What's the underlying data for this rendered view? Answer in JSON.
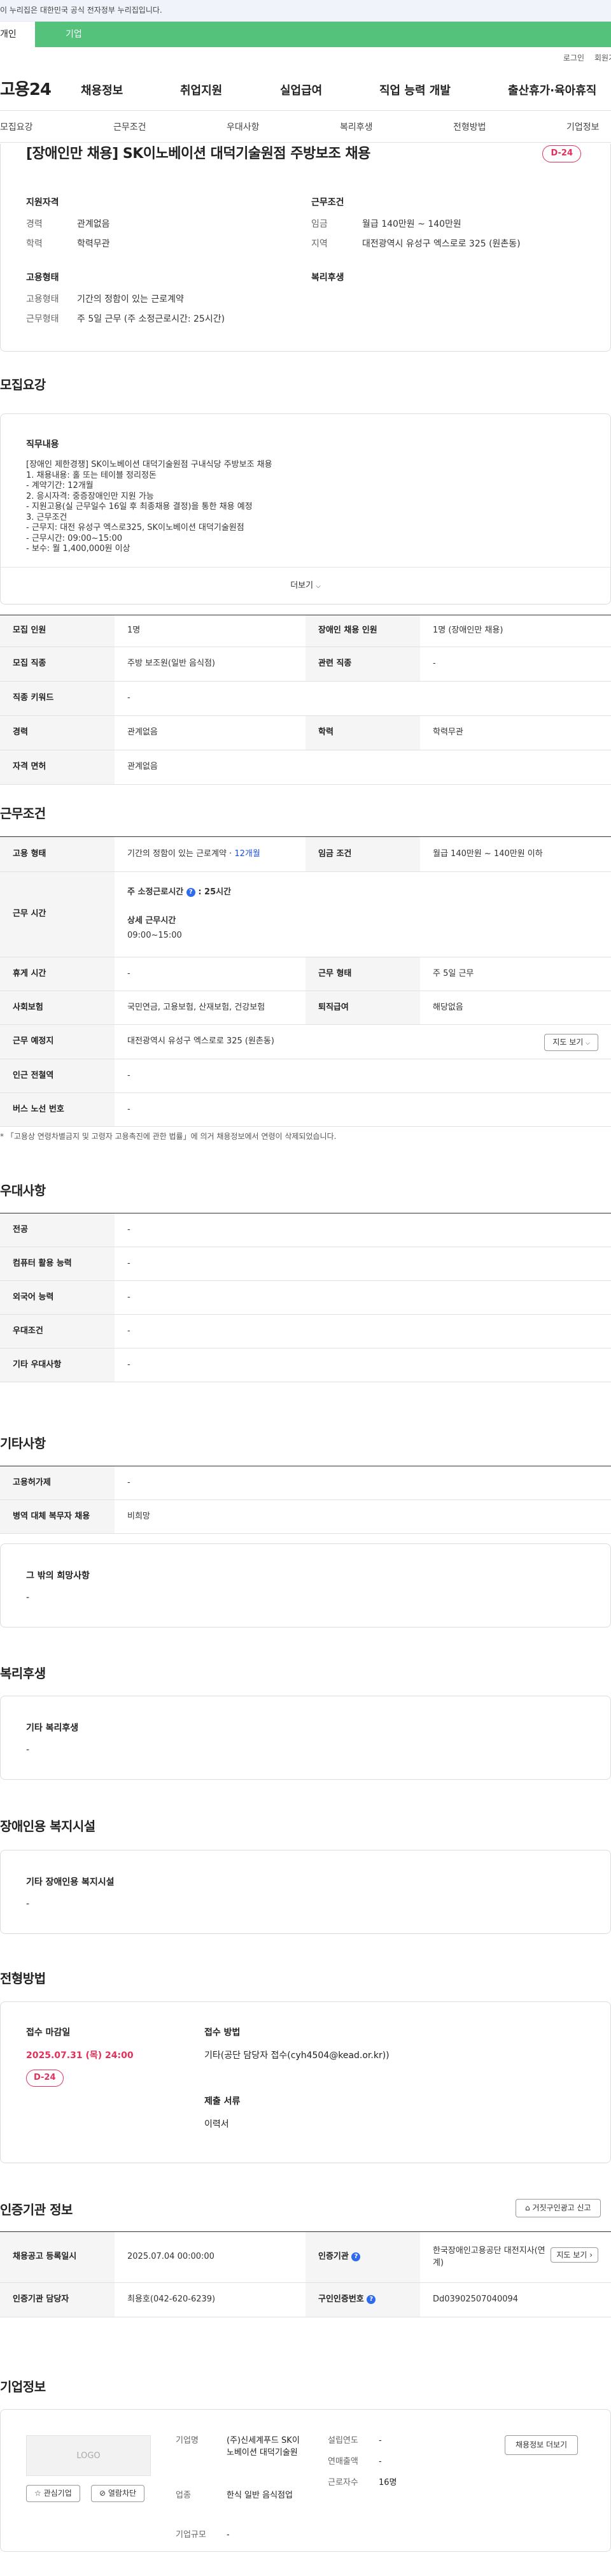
{
  "gov_banner": "이 누리집은 대한민국 공식 전자정부 누리집입니다.",
  "top_tabs": [
    "개인",
    "기업"
  ],
  "util_links": [
    "로그인",
    "회원가입"
  ],
  "logo": "고용24",
  "gnb": [
    "채용정보",
    "취업지원",
    "실업급여",
    "직업 능력 개발",
    "출산휴가·육아휴직"
  ],
  "subnav": [
    "모집요강",
    "근무조건",
    "우대사항",
    "복리후생",
    "전형방법",
    "기업정보"
  ],
  "job": {
    "title": "[장애인만 채용] SK이노베이션 대덕기술원점 주방보조 채용",
    "dday": "D-24",
    "qual_h": "지원자격",
    "career_k": "경력",
    "career_v": "관계없음",
    "edu_k": "학력",
    "edu_v": "학력무관",
    "work_h": "근무조건",
    "wage_k": "임금",
    "wage_v": "월급 140만원 ~ 140만원",
    "loc_k": "지역",
    "loc_v": "대전광역시 유성구 엑스로로 325 (원촌동)",
    "emp_h": "고용형태",
    "etype_k": "고용형태",
    "etype_v": "기간의 정함이 있는 근로계약",
    "wform_k": "근무형태",
    "wform_v": "주 5일 근무 (주 소정근로시간: 25시간)",
    "welfare_h": "복리후생"
  },
  "recruit": {
    "heading": "모집요강",
    "duty_h": "직무내용",
    "duty_lines": [
      "[장애인 제한경쟁] SK이노베이션 대덕기술원점 구내식당 주방보조 채용",
      "1. 채용내용: 홀 또는 테이블 정리정돈",
      " - 계약기간: 12개월",
      "2. 응시자격: 중증장애인만 지원 가능",
      " - 지원고용(실 근무일수 16일 후 최종채용 결정)을 통한 채용 예정",
      "3. 근무조건",
      " - 근무지: 대전 유성구 엑스로325, SK이노베이션 대덕기술원점",
      " - 근무시간: 09:00~15:00",
      " - 보수: 월 1,400,000원 이상"
    ],
    "more": "더보기",
    "rows": [
      [
        "모집 인원",
        "1명",
        "장애인 채용 인원",
        "1명 (장애인만 채용)"
      ],
      [
        "모집 직종",
        "주방 보조원(일반 음식점)",
        "관련 직종",
        "-"
      ],
      [
        "직종 키워드",
        "-"
      ],
      [
        "경력",
        "관계없음",
        "학력",
        "학력무관"
      ],
      [
        "자격 면허",
        "관계없음"
      ]
    ]
  },
  "work": {
    "heading": "근무조건",
    "etype_k": "고용 형태",
    "etype_v": "기간의 정함이 있는 근로계약 · ",
    "etype_months": "12개월",
    "wage_k": "임금 조건",
    "wage_v": "월급 140만원 ~ 140만원 이하",
    "hours_k": "근무 시간",
    "hours_main_label": "주 소정근로시간",
    "hours_main_val": ": 25시간",
    "hours_detail_label": "상세 근무시간",
    "hours_detail_val": "09:00~15:00",
    "rest_k": "휴게 시간",
    "rest_v": "-",
    "wform_k": "근무 형태",
    "wform_v": "주 5일 근무",
    "ins_k": "사회보험",
    "ins_v": "국민연금, 고용보험, 산재보험, 건강보험",
    "sev_k": "퇴직급여",
    "sev_v": "해당없음",
    "place_k": "근무 예정지",
    "place_v": "대전광역시 유성구 엑스로로 325 (원촌동)",
    "map_btn": "지도 보기",
    "sub_k": "인근 전철역",
    "sub_v": "-",
    "bus_k": "버스 노선 번호",
    "bus_v": "-",
    "note": "「고용상 연령차별금지 및 고령자 고용촉진에 관한 법률」에 의거 채용정보에서 연령이 삭제되었습니다."
  },
  "pref": {
    "heading": "우대사항",
    "rows": [
      [
        "전공",
        "-"
      ],
      [
        "컴퓨터 활용 능력",
        "-"
      ],
      [
        "외국어 능력",
        "-"
      ],
      [
        "우대조건",
        "-"
      ],
      [
        "기타 우대사항",
        "-"
      ]
    ]
  },
  "etc": {
    "heading": "기타사항",
    "rows": [
      [
        "고용허가제",
        "-"
      ],
      [
        "병역 대체 복무자 채용",
        "비희망"
      ]
    ],
    "other_h": "그 밖의 희망사항",
    "other_v": "-"
  },
  "welfare": {
    "heading": "복리후생",
    "box_h": "기타 복리후생",
    "box_v": "-"
  },
  "disab": {
    "heading": "장애인용 복지시설",
    "box_h": "기타 장애인용 복지시설",
    "box_v": "-"
  },
  "process": {
    "heading": "전형방법",
    "deadline_h": "접수 마감일",
    "deadline_v": "2025.07.31 (목) 24:00",
    "dday": "D-24",
    "method_h": "접수 방법",
    "method_v": "기타(공단 담당자 접수(cyh4504@kead.or.kr))",
    "docs_h": "제출 서류",
    "docs_v": "이력서"
  },
  "cert": {
    "heading": "인증기관 정보",
    "report_btn": "거짓구인광고 신고",
    "reg_k": "채용공고 등록일시",
    "reg_v": "2025.07.04 00:00:00",
    "org_k": "인증기관",
    "org_v": "한국장애인고용공단 대전지사(연계)",
    "map_btn": "지도 보기",
    "mgr_k": "인증기관 담당자",
    "mgr_v": "최용호(042-620-6239)",
    "num_k": "구인인증번호",
    "num_v": "Dd03902507040094"
  },
  "company": {
    "heading": "기업정보",
    "logo_ph": "LOGO",
    "fav_btn": "관심기업",
    "block_btn": "열람차단",
    "name_k": "기업명",
    "name_v": "(주)신세계푸드 SK이노베이션 대덕기술원",
    "ind_k": "업종",
    "ind_v": "한식 일반 음식점업",
    "size_k": "기업규모",
    "size_v": "-",
    "year_k": "설립연도",
    "year_v": "-",
    "sales_k": "연매출액",
    "sales_v": "-",
    "emp_k": "근로자수",
    "emp_v": "16명",
    "more_btn": "채용정보 더보기"
  }
}
